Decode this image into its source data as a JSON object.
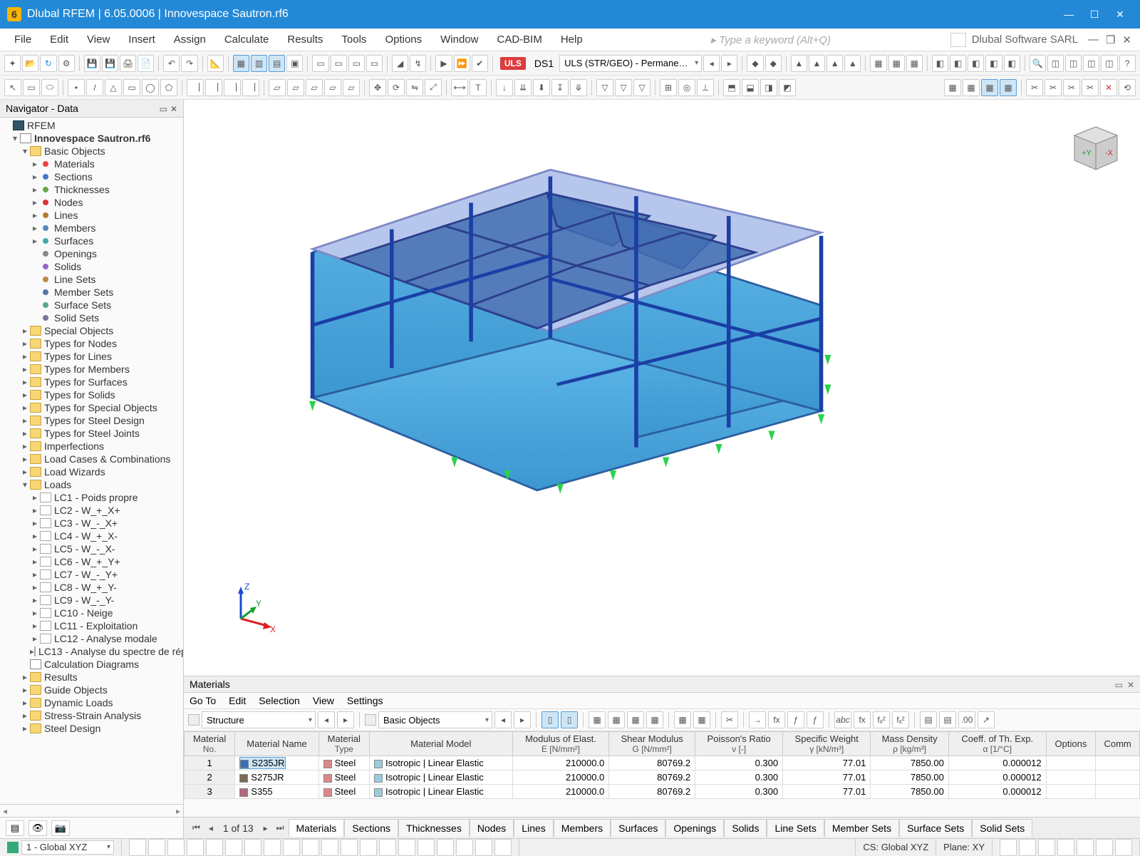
{
  "window": {
    "title": "Dlubal RFEM | 6.05.0006 | Innovespace Sautron.rf6"
  },
  "brand": "Dlubal Software SARL",
  "menu": [
    "File",
    "Edit",
    "View",
    "Insert",
    "Assign",
    "Calculate",
    "Results",
    "Tools",
    "Options",
    "Window",
    "CAD-BIM",
    "Help"
  ],
  "search_placeholder": "Type a keyword (Alt+Q)",
  "toolbar2": {
    "uls": "ULS",
    "ds1": "DS1",
    "combo": "ULS (STR/GEO) - Permane…"
  },
  "sidebar": {
    "title": "Navigator - Data",
    "root": "RFEM",
    "model": "Innovespace Sautron.rf6",
    "basic": {
      "label": "Basic Objects",
      "items": [
        "Materials",
        "Sections",
        "Thicknesses",
        "Nodes",
        "Lines",
        "Members",
        "Surfaces",
        "Openings",
        "Solids",
        "Line Sets",
        "Member Sets",
        "Surface Sets",
        "Solid Sets"
      ]
    },
    "folders": [
      "Special Objects",
      "Types for Nodes",
      "Types for Lines",
      "Types for Members",
      "Types for Surfaces",
      "Types for Solids",
      "Types for Special Objects",
      "Types for Steel Design",
      "Types for Steel Joints",
      "Imperfections",
      "Load Cases & Combinations",
      "Load Wizards"
    ],
    "loads": {
      "label": "Loads",
      "items": [
        "LC1 - Poids propre",
        "LC2 - W_+_X+",
        "LC3 - W_-_X+",
        "LC4 - W_+_X-",
        "LC5 - W_-_X-",
        "LC6 - W_+_Y+",
        "LC7 - W_-_Y+",
        "LC8 - W_+_Y-",
        "LC9 - W_-_Y-",
        "LC10 - Neige",
        "LC11 - Exploitation",
        "LC12 - Analyse modale",
        "LC13 - Analyse du spectre de rép"
      ]
    },
    "after_loads": [
      "Calculation Diagrams",
      "Results",
      "Guide Objects",
      "Dynamic Loads",
      "Stress-Strain Analysis",
      "Steel Design"
    ]
  },
  "axes": {
    "x": "X",
    "y": "Y",
    "z": "Z"
  },
  "materials": {
    "title": "Materials",
    "menu": [
      "Go To",
      "Edit",
      "Selection",
      "View",
      "Settings"
    ],
    "dd1": "Structure",
    "dd2": "Basic Objects",
    "headers": {
      "no": "Material",
      "no_u": "No.",
      "name": "Material Name",
      "type": "Material",
      "type_u": "Type",
      "model": "Material Model",
      "E": "Modulus of Elast.",
      "E_u": "E [N/mm²]",
      "G": "Shear Modulus",
      "G_u": "G [N/mm²]",
      "nu": "Poisson's Ratio",
      "nu_u": "ν [-]",
      "gamma": "Specific Weight",
      "gamma_u": "γ [kN/m³]",
      "rho": "Mass Density",
      "rho_u": "ρ [kg/m³]",
      "alpha": "Coeff. of Th. Exp.",
      "alpha_u": "α [1/°C]",
      "opt": "Options",
      "comm": "Comm"
    },
    "rows": [
      {
        "no": "1",
        "name": "S235JR",
        "sw": "#3a6fb7",
        "type": "Steel",
        "model": "Isotropic | Linear Elastic",
        "E": "210000.0",
        "G": "80769.2",
        "nu": "0.300",
        "gamma": "77.01",
        "rho": "7850.00",
        "alpha": "0.000012"
      },
      {
        "no": "2",
        "name": "S275JR",
        "sw": "#7a6a56",
        "type": "Steel",
        "model": "Isotropic | Linear Elastic",
        "E": "210000.0",
        "G": "80769.2",
        "nu": "0.300",
        "gamma": "77.01",
        "rho": "7850.00",
        "alpha": "0.000012"
      },
      {
        "no": "3",
        "name": "S355",
        "sw": "#b16a7a",
        "type": "Steel",
        "model": "Isotropic | Linear Elastic",
        "E": "210000.0",
        "G": "80769.2",
        "nu": "0.300",
        "gamma": "77.01",
        "rho": "7850.00",
        "alpha": "0.000012"
      }
    ]
  },
  "tabs": {
    "page": "1 of 13",
    "list": [
      "Materials",
      "Sections",
      "Thicknesses",
      "Nodes",
      "Lines",
      "Members",
      "Surfaces",
      "Openings",
      "Solids",
      "Line Sets",
      "Member Sets",
      "Surface Sets",
      "Solid Sets"
    ]
  },
  "status": {
    "cs_dd": "1 - Global XYZ",
    "cs": "CS: Global XYZ",
    "plane": "Plane: XY"
  }
}
